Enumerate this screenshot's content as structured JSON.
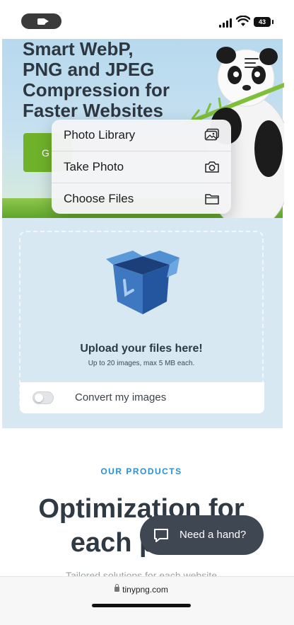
{
  "status_bar": {
    "battery_level": "43",
    "camera_indicator_icon": "video-camera-icon",
    "signal_icon": "cellular-signal-icon",
    "wifi_icon": "wifi-icon"
  },
  "hero": {
    "title_lines": [
      "Smart WebP,",
      "PNG and JPEG",
      "Compression for",
      "Faster Websites"
    ],
    "button_partial_label": "G",
    "menu_icon": "hamburger-menu-icon",
    "mascot_icon": "panda-mascot-icon"
  },
  "file_menu": {
    "items": [
      {
        "label": "Photo Library",
        "icon": "photo-library-icon"
      },
      {
        "label": "Take Photo",
        "icon": "camera-icon"
      },
      {
        "label": "Choose Files",
        "icon": "folder-icon"
      }
    ]
  },
  "upload": {
    "title": "Upload your files here!",
    "subtitle": "Up to 20 images, max 5 MB each.",
    "icon": "open-box-icon",
    "convert_label": "Convert my images",
    "convert_enabled": false
  },
  "products": {
    "eyebrow": "OUR PRODUCTS",
    "heading_lines": [
      "Optimization for",
      "each p"
    ],
    "faded_partial": "Tailored solutions for each website"
  },
  "chat": {
    "label": "Need a hand?",
    "icon": "chat-bubble-icon"
  },
  "browser": {
    "url": "tinypng.com",
    "lock_icon": "lock-icon"
  },
  "colors": {
    "accent_green": "#6fb22a",
    "accent_blue": "#2b8fd6",
    "dark_text": "#2f3a44",
    "chat_bg": "#3e4752"
  }
}
